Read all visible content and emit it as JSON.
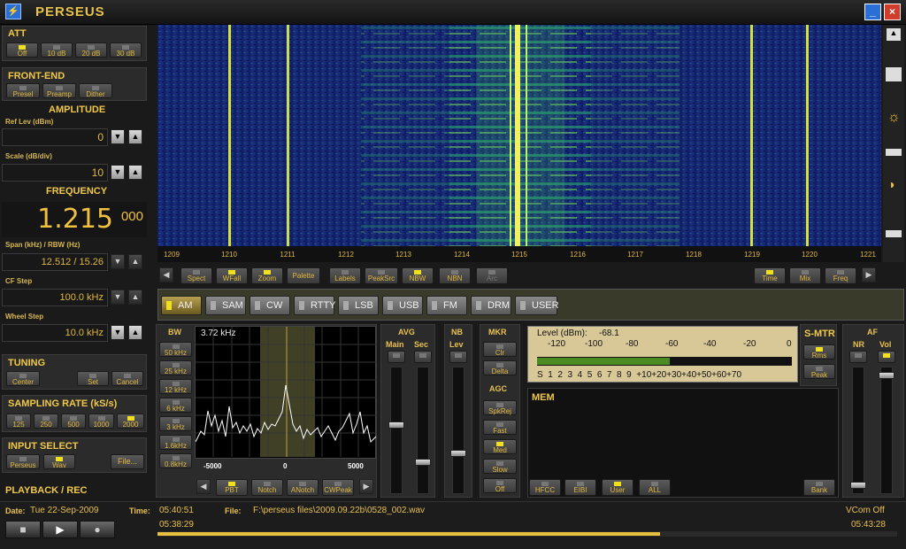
{
  "app": {
    "title": "PERSEUS",
    "icon": "perseus-app-icon"
  },
  "window": {
    "minimize": "_",
    "close": "×"
  },
  "att": {
    "title": "ATT",
    "buttons": [
      "Off",
      "10 dB",
      "20 dB",
      "30 dB"
    ],
    "active": 0
  },
  "frontend": {
    "title": "FRONT-END",
    "buttons": [
      "Presel",
      "Preamp",
      "Dither"
    ]
  },
  "amplitude": {
    "title": "AMPLITUDE",
    "ref_label": "Ref Lev (dBm)",
    "ref_value": "0",
    "scale_label": "Scale (dB/div)",
    "scale_value": "10"
  },
  "frequency": {
    "title": "FREQUENCY",
    "main": "1.215",
    "sub": "000",
    "span_label": "Span (kHz) / RBW (Hz)",
    "span_value": "12.512 / 15.26",
    "cf_label": "CF Step",
    "cf_value": "100.0 kHz",
    "wheel_label": "Wheel Step",
    "wheel_value": "10.0 kHz"
  },
  "tuning": {
    "title": "TUNING",
    "buttons": [
      "Center",
      "Set",
      "Cancel"
    ]
  },
  "sampling": {
    "title": "SAMPLING RATE (kS/s)",
    "buttons": [
      "125",
      "250",
      "500",
      "1000",
      "2000"
    ],
    "active": 4
  },
  "input": {
    "title": "INPUT SELECT",
    "buttons": [
      "Perseus",
      "Wav",
      "File..."
    ],
    "active": 1
  },
  "playback": {
    "title": "PLAYBACK / REC"
  },
  "spectrum_scale": {
    "ticks": [
      "1209",
      "1210",
      "1211",
      "1212",
      "1213",
      "1214",
      "1215",
      "1216",
      "1217",
      "1218",
      "1219",
      "1220",
      "1221"
    ]
  },
  "spec_toolbar": {
    "left": [
      "Spect",
      "WFall",
      "Zoom",
      "Palette",
      "Labels",
      "PeakSrc",
      "NBW",
      "NBN",
      "Arc"
    ],
    "right": [
      "Time",
      "Mix",
      "Freq"
    ]
  },
  "modes": {
    "items": [
      "AM",
      "SAM",
      "CW",
      "RTTY",
      "LSB",
      "USB",
      "FM",
      "DRM",
      "USER"
    ],
    "active": 0
  },
  "bw": {
    "title": "BW",
    "buttons": [
      "50 kHz",
      "25 kHz",
      "12 kHz",
      "6 kHz",
      "3 kHz",
      "1.6kHz",
      "0.8kHz"
    ],
    "readout": "3.72 kHz",
    "axis": [
      "-5000",
      "0",
      "5000"
    ]
  },
  "filter_toolbar": {
    "buttons": [
      "PBT",
      "Notch",
      "ANotch",
      "CWPeak"
    ]
  },
  "avg": {
    "title": "AVG",
    "main": "Main",
    "sec": "Sec"
  },
  "nb": {
    "title": "NB",
    "lev": "Lev"
  },
  "mkr": {
    "title": "MKR",
    "buttons": [
      "Clr",
      "Delta"
    ]
  },
  "agc": {
    "title": "AGC",
    "buttons": [
      "SpkRej",
      "Fast",
      "Med",
      "Slow",
      "Off"
    ],
    "active": 2
  },
  "smeter": {
    "level_label": "Level (dBm):",
    "level_value": "-68.1",
    "top_scale": [
      "-120",
      "-100",
      "-80",
      "-60",
      "-40",
      "-20",
      "0"
    ],
    "bottom_scale": "S  1  2  3  4  5  6  7  8  9  +10+20+30+40+50+60+70",
    "fill": 0.52
  },
  "smtr": {
    "title": "S-MTR",
    "buttons": [
      "Rms",
      "Peak"
    ]
  },
  "af": {
    "title": "AF",
    "nr": "NR",
    "vol": "Vol"
  },
  "mem": {
    "title": "MEM",
    "buttons": [
      "HFCC",
      "EIBI",
      "User",
      "ALL"
    ],
    "bank": "Bank"
  },
  "status": {
    "date_label": "Date:",
    "date_value": "Tue 22-Sep-2009",
    "time_label": "Time:",
    "time_value": "05:40:51",
    "file_label": "File:",
    "file_value": "F:\\perseus files\\2009.09.22b\\0528_002.wav",
    "vcom": "VCom Off",
    "start": "05:38:29",
    "end": "05:43:28",
    "progress": 0.68
  }
}
